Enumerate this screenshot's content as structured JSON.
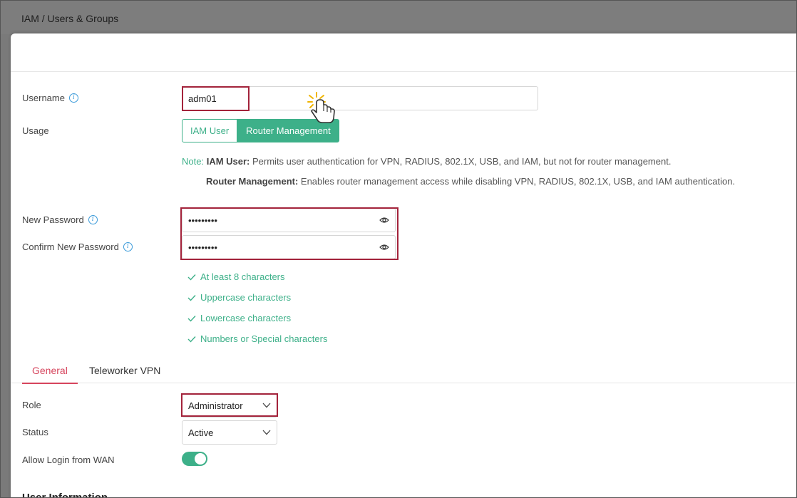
{
  "breadcrumb": "IAM / Users & Groups",
  "form": {
    "username": {
      "label": "Username",
      "value": "adm01"
    },
    "usage": {
      "label": "Usage",
      "options": [
        "IAM User",
        "Router Management"
      ],
      "selected": "Router Management"
    },
    "note": {
      "prefix": "Note:",
      "iam_title": "IAM User:",
      "iam_text": " Permits user authentication for VPN, RADIUS, 802.1X, USB, and IAM, but not for router management.",
      "router_title": "Router Management:",
      "router_text": " Enables router management access while disabling VPN, RADIUS, 802.1X, USB, and IAM authentication."
    },
    "new_password": {
      "label": "New Password",
      "value": "•••••••••"
    },
    "confirm_password": {
      "label": "Confirm New Password",
      "value": "•••••••••"
    },
    "rules": [
      "At least 8 characters",
      "Uppercase characters",
      "Lowercase characters",
      "Numbers or Special characters"
    ]
  },
  "tabs": {
    "general": "General",
    "teleworker": "Teleworker VPN",
    "active": "General"
  },
  "general": {
    "role": {
      "label": "Role",
      "value": "Administrator"
    },
    "status": {
      "label": "Status",
      "value": "Active"
    },
    "wan": {
      "label": "Allow Login from WAN",
      "enabled": true
    }
  },
  "next_section_title": "User Information",
  "colors": {
    "accent_green": "#3db089",
    "tab_active": "#d6455d",
    "highlight": "#a3233b"
  }
}
